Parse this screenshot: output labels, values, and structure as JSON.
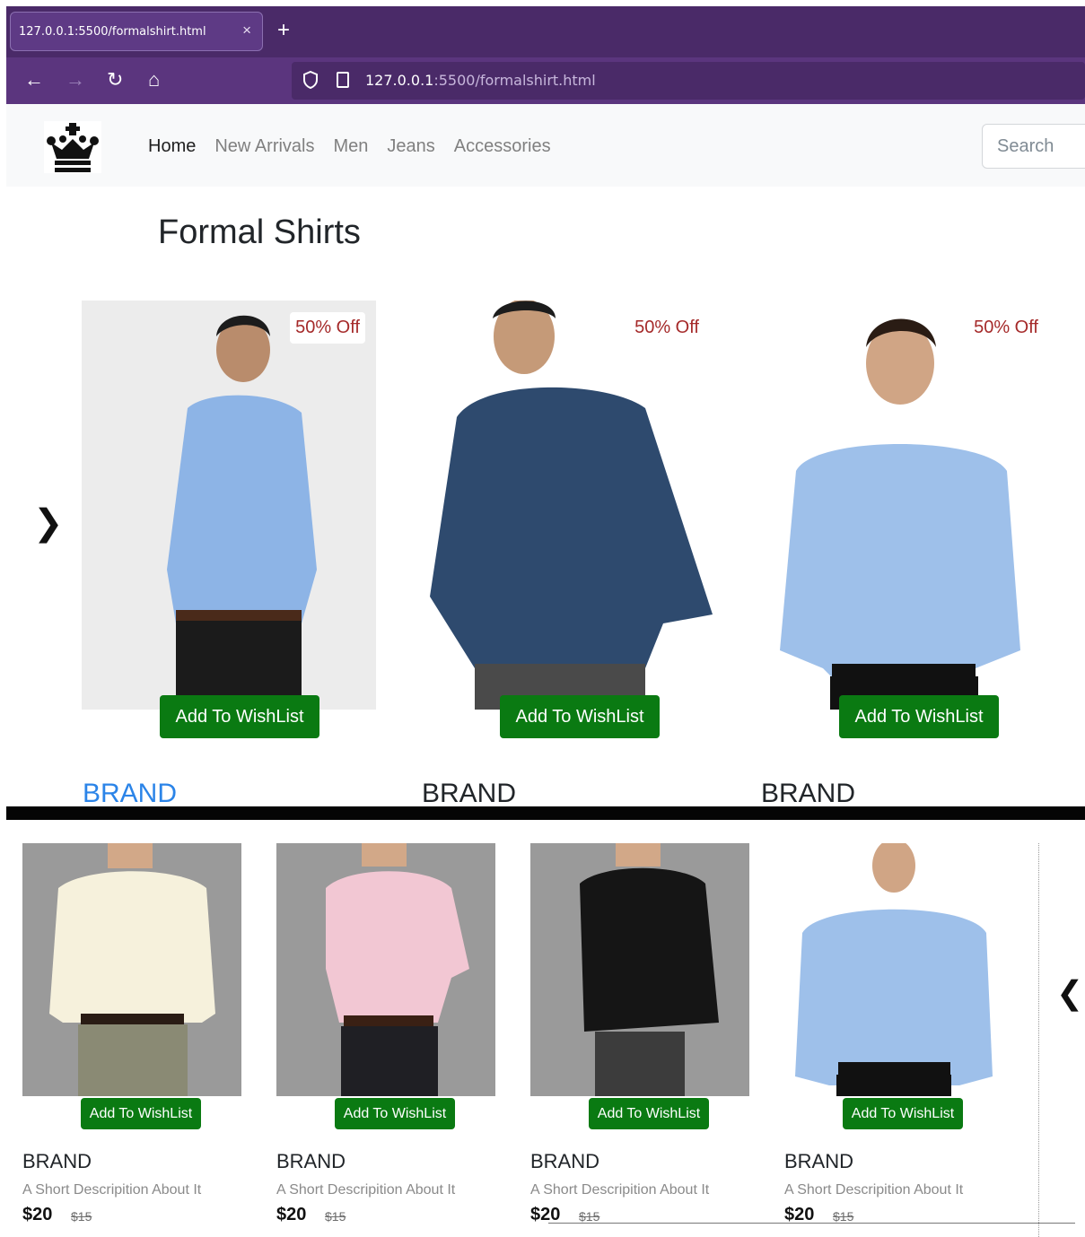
{
  "browser": {
    "tab_title": "127.0.0.1:5500/formalshirt.html",
    "tab_close": "×",
    "new_tab": "+",
    "back": "←",
    "forward": "→",
    "reload": "↻",
    "home": "⌂",
    "url_host": "127.0.0.1",
    "url_rest": ":5500/formalshirt.html"
  },
  "navbar": {
    "links": [
      "Home",
      "New Arrivals",
      "Men",
      "Jeans",
      "Accessories"
    ],
    "active_index": 0,
    "search_placeholder": "Search"
  },
  "page": {
    "title": "Formal Shirts"
  },
  "carousel_top": {
    "prev": "❯",
    "cards": [
      {
        "discount": "50% Off",
        "button": "Add To WishList",
        "brand": "BRAND",
        "shirt_color": "#8db4e6",
        "bg": "#ececec"
      },
      {
        "discount": "50% Off",
        "button": "Add To WishList",
        "brand": "BRAND",
        "shirt_color": "#2e4a6e",
        "bg": "#ffffff"
      },
      {
        "discount": "50% Off",
        "button": "Add To WishList",
        "brand": "BRAND",
        "shirt_color": "#9ec0ea",
        "bg": "#ffffff"
      }
    ]
  },
  "carousel_bottom": {
    "next": "❮",
    "cards": [
      {
        "button": "Add To WishList",
        "brand": "BRAND",
        "description": "A Short Descripition About It",
        "price": "$20",
        "old_price": "$15",
        "shirt_color": "#f6f1dc",
        "bg": "#9a9a9a"
      },
      {
        "button": "Add To WishList",
        "brand": "BRAND",
        "description": "A Short Descripition About It",
        "price": "$20",
        "old_price": "$15",
        "shirt_color": "#f2c7d3",
        "bg": "#9a9a9a"
      },
      {
        "button": "Add To WishList",
        "brand": "BRAND",
        "description": "A Short Descripition About It",
        "price": "$20",
        "old_price": "$15",
        "shirt_color": "#151515",
        "bg": "#9a9a9a"
      },
      {
        "button": "Add To WishList",
        "brand": "BRAND",
        "description": "A Short Descripition About It",
        "price": "$20",
        "old_price": "$15",
        "shirt_color": "#9ec0ea",
        "bg": "#ffffff"
      }
    ]
  },
  "colors": {
    "wishlist_green": "#0a7a12",
    "discount_red": "#a52a2a",
    "link_blue": "#2b84e8",
    "browser_purple": "#4a2a68"
  }
}
